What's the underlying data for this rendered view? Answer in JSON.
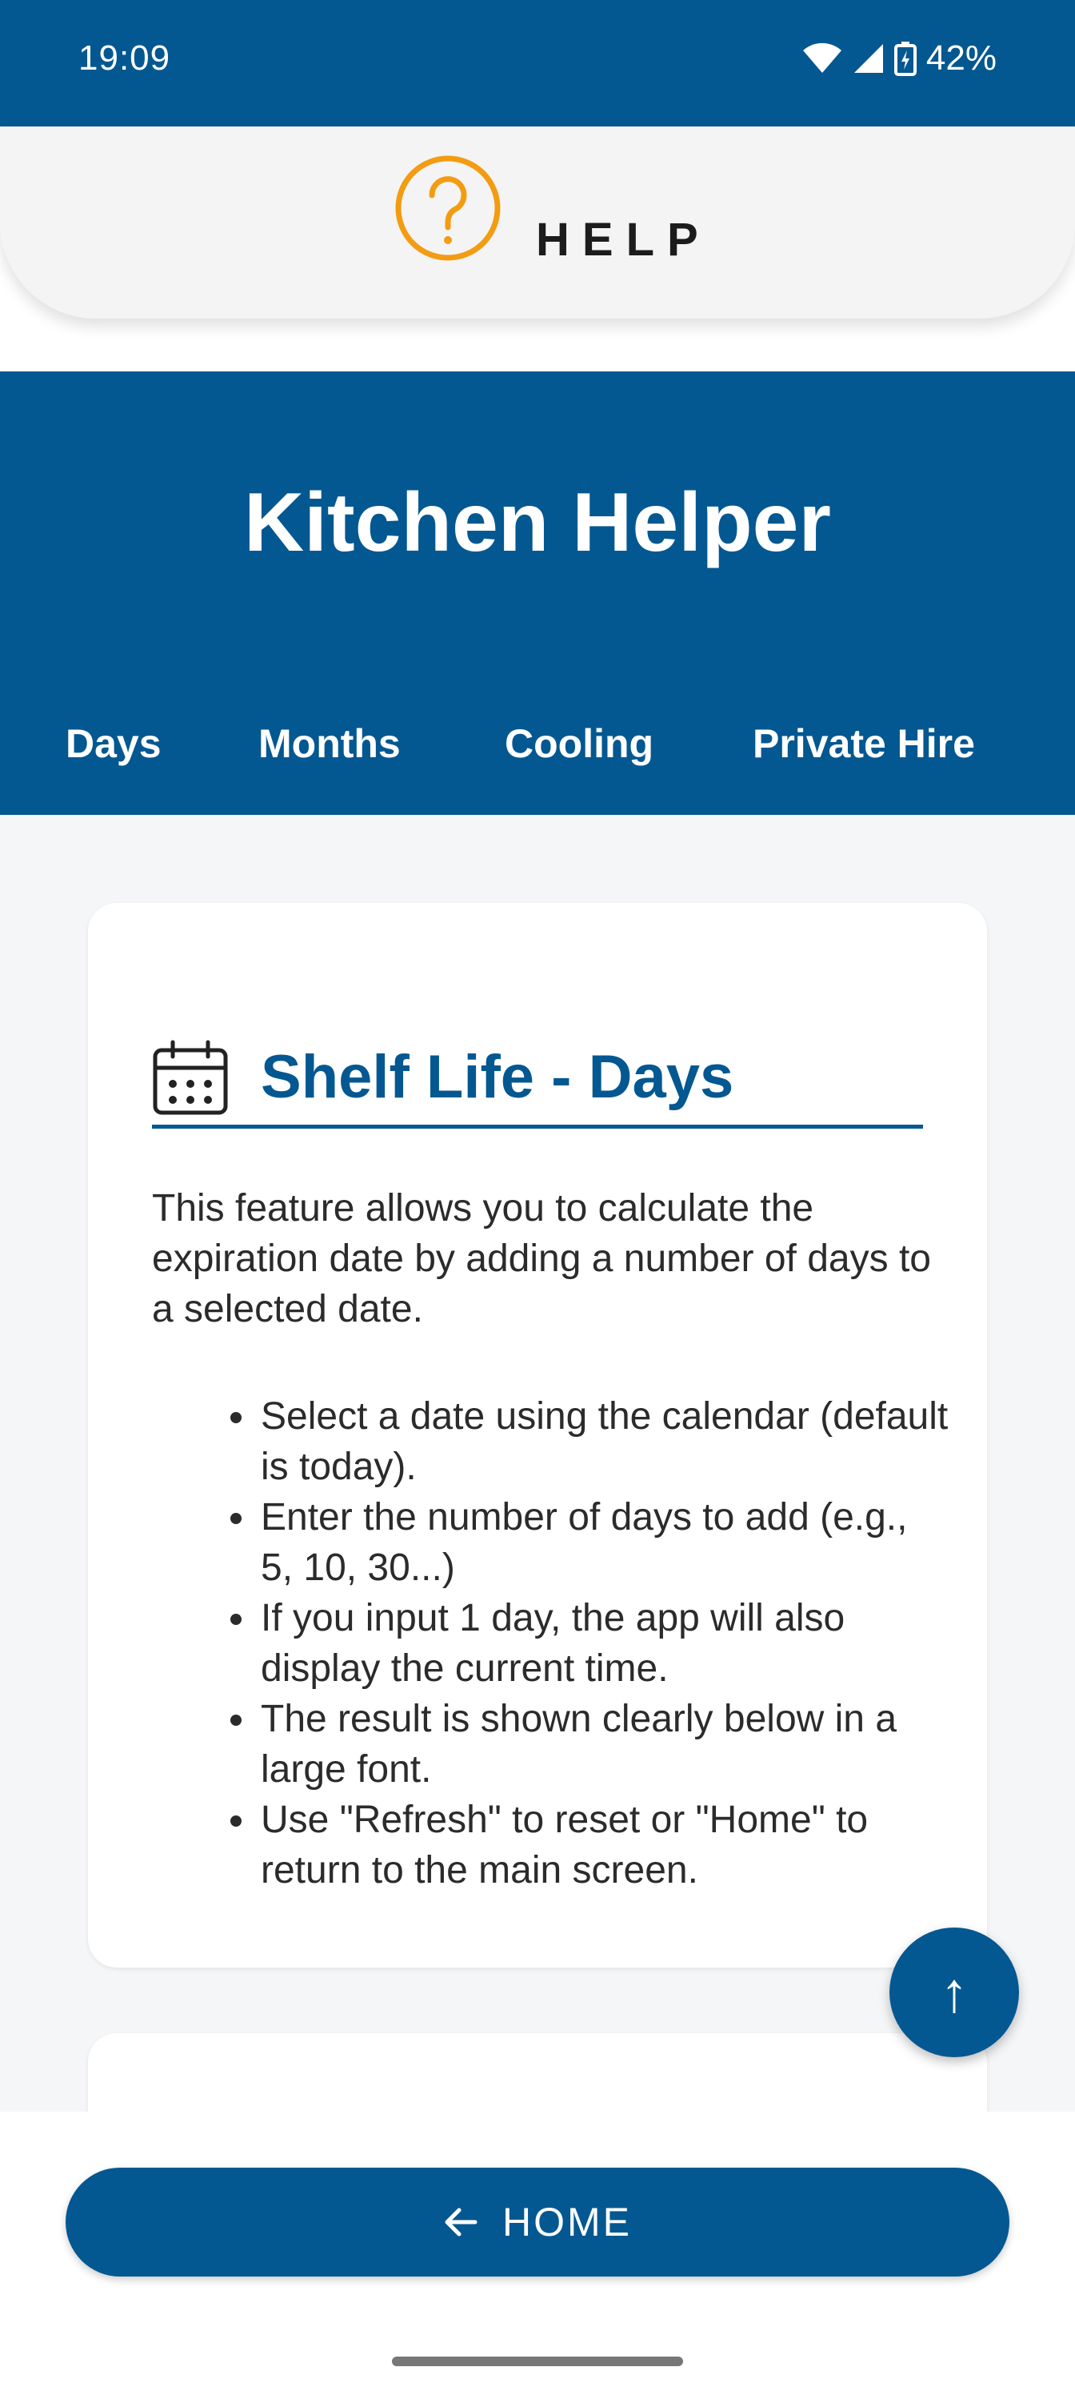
{
  "status_bar": {
    "time": "19:09",
    "battery": "42%"
  },
  "help_header": {
    "label": "HELP",
    "icon": "question-circle-icon",
    "icon_color": "#F39C12"
  },
  "app": {
    "title": "Kitchen Helper",
    "tabs": [
      "Days",
      "Months",
      "Cooling",
      "Private Hire"
    ],
    "accent_color": "#045891"
  },
  "section": {
    "icon": "calendar-icon",
    "title": "Shelf Life - Days",
    "intro": "This feature allows you to calculate the expiration date by adding a number of days to a selected date.",
    "bullets": [
      "Select a date using the calendar (default is today).",
      "Enter the number of days to add (e.g., 5, 10, 30...)",
      "If you input 1 day, the app will also display the current time.",
      "The result is shown clearly below in a large font.",
      "Use \"Refresh\" to reset or \"Home\" to return to the main screen."
    ]
  },
  "scroll_top_button": {
    "icon": "arrow-up-icon",
    "symbol": "↑"
  },
  "home_button": {
    "icon": "arrow-left-icon",
    "label": "HOME"
  }
}
